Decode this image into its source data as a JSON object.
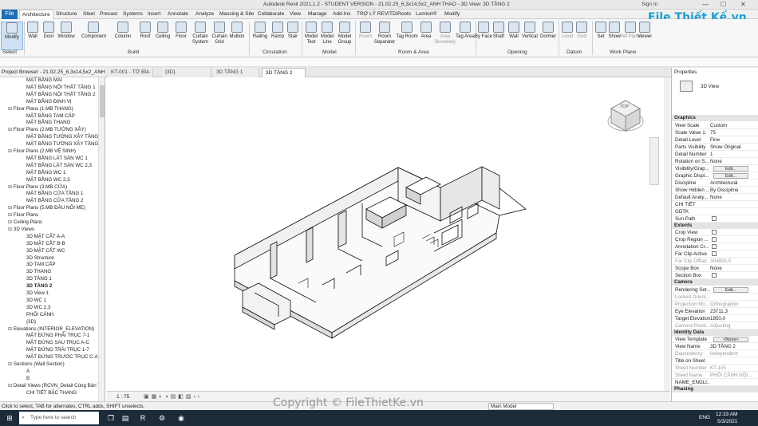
{
  "titlebar": {
    "title": "Autodesk Revit 2021.1.2 - STUDENT VERSION - 21.02.25_6,3x14,5x2_ANH THAO - 3D View: 3D TẦNG 2",
    "signin": "Sign In"
  },
  "menu": [
    "File",
    "Architecture",
    "Structure",
    "Steel",
    "Precast",
    "Systems",
    "Insert",
    "Annotate",
    "Analyze",
    "Massing & Site",
    "Collaborate",
    "View",
    "Manage",
    "Add-Ins",
    "TRỢ LÝ REVIT",
    "DiRoots",
    "Lumion®",
    "Modify"
  ],
  "ribbon": {
    "buttons": [
      "Modify",
      "Wall",
      "Door",
      "Window",
      "Component",
      "Column",
      "Roof",
      "Ceiling",
      "Floor",
      "Curtain System",
      "Curtain Grid",
      "Mullion",
      "Railing",
      "Ramp",
      "Stair",
      "Model Text",
      "Model Line",
      "Model Group",
      "Room",
      "Room Separator",
      "Tag Room",
      "Area",
      "Area Boundary",
      "Tag Area",
      "By Face",
      "Shaft",
      "Wall",
      "Vertical",
      "Dormer",
      "Level",
      "Grid",
      "Set",
      "Show",
      "Ref Plane",
      "Viewer"
    ],
    "groups": [
      "Select",
      "Build",
      "Circulation",
      "Model",
      "Room & Area",
      "Opening",
      "Datum",
      "Work Plane"
    ]
  },
  "view_tabs": [
    "KT-001 - TỜ BÌA",
    "{3D}",
    "3D TẦNG 1",
    "3D TẦNG 2"
  ],
  "project_browser": {
    "title": "Project Browser - 21.02.25_6,3x14,5x2_ANH...",
    "items": [
      {
        "t": "MẶT BẰNG MÁI",
        "l": 2
      },
      {
        "t": "MẶT BẰNG NỘI THẤT TẦNG 1",
        "l": 2
      },
      {
        "t": "MẶT BẰNG NỘI THẤT TẦNG 2",
        "l": 2
      },
      {
        "t": "MẶT BẰNG ĐỊNH VỊ",
        "l": 2
      },
      {
        "t": "Floor Plans (1.MB THANG)",
        "l": 1
      },
      {
        "t": "MẶT BẰNG TAM CẤP",
        "l": 2
      },
      {
        "t": "MẶT BẰNG THANG",
        "l": 2
      },
      {
        "t": "Floor Plans (2.MB TƯỜNG XÂY)",
        "l": 1
      },
      {
        "t": "MẶT BẰNG TƯỜNG XÂY TẦNG 1",
        "l": 2
      },
      {
        "t": "MẶT BẰNG TƯỜNG XÂY TẦNG 2",
        "l": 2
      },
      {
        "t": "Floor Plans (2.MB VỆ SINH)",
        "l": 1
      },
      {
        "t": "MẶT BẰNG LÁT SÀN WC 1",
        "l": 2
      },
      {
        "t": "MẶT BẰNG LÁT SÀN WC 2,3",
        "l": 2
      },
      {
        "t": "MẶT BẰNG WC 1",
        "l": 2
      },
      {
        "t": "MẶT BẰNG WC 2,3",
        "l": 2
      },
      {
        "t": "Floor Plans (3.MB CỬA)",
        "l": 1
      },
      {
        "t": "MẶT BẰNG CỬA TẦNG 1",
        "l": 2
      },
      {
        "t": "MẶT BẰNG CỬA TẦNG 2",
        "l": 2
      },
      {
        "t": "Floor Plans (5.MB ĐẦU NỐI ME)",
        "l": 1
      },
      {
        "t": "Floor Plans",
        "l": 1
      },
      {
        "t": "Ceiling Plans",
        "l": 1
      },
      {
        "t": "3D Views",
        "l": 1
      },
      {
        "t": "3D MẶT CẮT A-A",
        "l": 2
      },
      {
        "t": "3D MẶT CẮT B-B",
        "l": 2
      },
      {
        "t": "3D MẶT CẮT WC",
        "l": 2
      },
      {
        "t": "3D Structure",
        "l": 2
      },
      {
        "t": "3D TAM CẤP",
        "l": 2
      },
      {
        "t": "3D THANG",
        "l": 2
      },
      {
        "t": "3D TẦNG 1",
        "l": 2
      },
      {
        "t": "3D TẦNG 2",
        "l": 2,
        "cur": true
      },
      {
        "t": "3D View 1",
        "l": 2
      },
      {
        "t": "3D WC 1",
        "l": 2
      },
      {
        "t": "3D WC 2,3",
        "l": 2
      },
      {
        "t": "PHỐI CẢNH",
        "l": 2
      },
      {
        "t": "{3D}",
        "l": 2
      },
      {
        "t": "Elevations (INTERIOR_ELEVATION)",
        "l": 1
      },
      {
        "t": "MẶT ĐỨNG PHẢI TRỤC 7-1",
        "l": 2
      },
      {
        "t": "MẶT ĐỨNG SAU TRỤC A-C",
        "l": 2
      },
      {
        "t": "MẶT ĐỨNG TRÁI TRỤC 1-7",
        "l": 2
      },
      {
        "t": "MẶT ĐỨNG TRƯỚC TRỤC C-A",
        "l": 2
      },
      {
        "t": "Sections (Wall Section)",
        "l": 1
      },
      {
        "t": "A",
        "l": 2
      },
      {
        "t": "B",
        "l": 2
      },
      {
        "t": "Detail Views (RCVN_Detail Cùng Bản Vẽ)",
        "l": 1
      },
      {
        "t": "CHI TIẾT BẬC THANG",
        "l": 2
      }
    ]
  },
  "properties": {
    "title": "Properties",
    "type_label": "3D View",
    "selector": "3D View: 3D TẦNG 2",
    "edit_type": "Edit Type",
    "sections": [
      {
        "name": "Graphics",
        "rows": [
          [
            "View Scale",
            "Custom"
          ],
          [
            "Scale Value 1:",
            "75"
          ],
          [
            "Detail Level",
            "Fine"
          ],
          [
            "Parts Visibility",
            "Show Original"
          ],
          [
            "Detail Number",
            "1"
          ],
          [
            "Rotation on S...",
            "None"
          ],
          [
            "Visibility/Grap...",
            "Edit...",
            1
          ],
          [
            "Graphic Displ...",
            "Edit...",
            1
          ],
          [
            "Discipline",
            "Architectural"
          ],
          [
            "Show Hidden ...",
            "By Discipline"
          ],
          [
            "Default Analy...",
            "None"
          ],
          [
            "CHI TIẾT",
            ""
          ],
          [
            "GDTK",
            ""
          ],
          [
            "Sun Path",
            "",
            2
          ]
        ]
      },
      {
        "name": "Extents",
        "rows": [
          [
            "Crop View",
            "",
            2
          ],
          [
            "Crop Region ...",
            "",
            2
          ],
          [
            "Annotation Cr...",
            "",
            2
          ],
          [
            "Far Clip Active",
            "",
            2
          ],
          [
            "Far Clip Offset",
            "304800,0",
            3
          ],
          [
            "Scope Box",
            "None"
          ],
          [
            "Section Box",
            "",
            2
          ]
        ]
      },
      {
        "name": "Camera",
        "rows": [
          [
            "Rendering Set...",
            "Edit...",
            1
          ],
          [
            "Locked Orient...",
            "",
            3
          ],
          [
            "Projection Mo...",
            "Orthographic",
            3
          ],
          [
            "Eye Elevation",
            "23711,3"
          ],
          [
            "Target Elevation",
            "1850,0"
          ],
          [
            "Camera Positi...",
            "Adjusting",
            3
          ]
        ]
      },
      {
        "name": "Identity Data",
        "rows": [
          [
            "View Template",
            "<None>",
            1
          ],
          [
            "View Name",
            "3D TẦNG 2"
          ],
          [
            "Dependency",
            "Independent",
            3
          ],
          [
            "Title on Sheet",
            ""
          ],
          [
            "Sheet Number",
            "KT-105",
            3
          ],
          [
            "Sheet Name",
            "PHỐI CẢNH NỘI...",
            3
          ],
          [
            "NAME_ENGLI...",
            ""
          ]
        ]
      },
      {
        "name": "Phasing",
        "rows": []
      }
    ],
    "help": "Properties help",
    "apply": "Apply"
  },
  "viewbar": {
    "scale": "1 : 75"
  },
  "statusbar": {
    "hint": "Click to select, TAB for alternates, CTRL adds, SHIFT unselects.",
    "model": "Main Model"
  },
  "viewcube": {
    "label": "TOP"
  },
  "taskbar": {
    "search": "Type here to search",
    "time": "12:33 AM",
    "date": "5/3/2021",
    "lang": "ENG"
  },
  "watermark": "File Thiết Kế.vn",
  "copyright": "Copyright © FileThietKe.vn",
  "colors": {
    "accent": "#1e6fb8",
    "taskbar": "#1c2a3a",
    "section": "#e4e4e4"
  }
}
